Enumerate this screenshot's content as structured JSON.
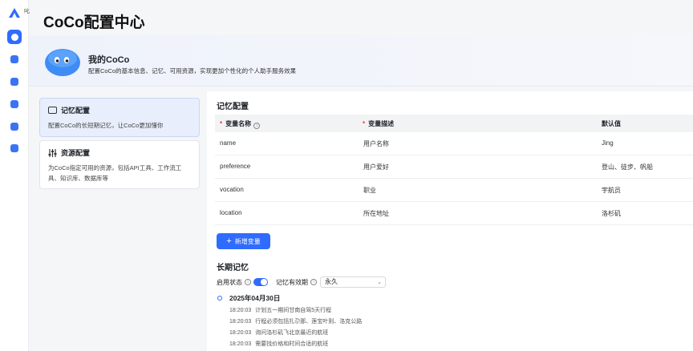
{
  "rail": {
    "logo_text": "叱",
    "items": [
      "home",
      "apps",
      "doc",
      "chat",
      "cloud",
      "message"
    ]
  },
  "page_title": "CoCo配置中心",
  "banner": {
    "title": "我的CoCo",
    "description": "配置CoCo的基本信息、记忆、可用资源，实现更加个性化的个人助手服务效果"
  },
  "nav": [
    {
      "title": "记忆配置",
      "desc": "配置CoCo的长短期记忆，让CoCo更加懂你"
    },
    {
      "title": "资源配置",
      "desc": "为CoCo指定可用的资源，包括API工具、工作流工具、知识库、数据库等"
    }
  ],
  "memory_config": {
    "title": "记忆配置",
    "req_mark": "*",
    "info_mark": "i",
    "columns": {
      "name": "变量名称",
      "desc": "变量描述",
      "default": "默认值"
    },
    "rows": [
      {
        "name": "name",
        "desc": "用户名称",
        "default": "Jing"
      },
      {
        "name": "preference",
        "desc": "用户爱好",
        "default": "登山、徒步、帆船"
      },
      {
        "name": "vocation",
        "desc": "职业",
        "default": "宇航员"
      },
      {
        "name": "location",
        "desc": "所在地址",
        "default": "洛杉矶"
      }
    ],
    "add_button": "新增变量",
    "add_plus": "+"
  },
  "long_term": {
    "title": "长期记忆",
    "enable_label": "启用状态",
    "validity_label": "记忆有效期",
    "validity_value": "永久",
    "chevron": "⌄",
    "date": "2025年04月30日",
    "entries": [
      {
        "time": "18:20:03",
        "text": "计划五一期间甘南自驾5天行程"
      },
      {
        "time": "18:20:03",
        "text": "行程必须包括扎尕那、莲宝叶则、洛克公路"
      },
      {
        "time": "18:20:03",
        "text": "询问洛杉矶飞北京最近的航班"
      },
      {
        "time": "18:20:03",
        "text": "需要找价格和时间合适的航班"
      }
    ]
  },
  "colors": {
    "accent": "#2f6bff",
    "required": "#e0433b"
  }
}
